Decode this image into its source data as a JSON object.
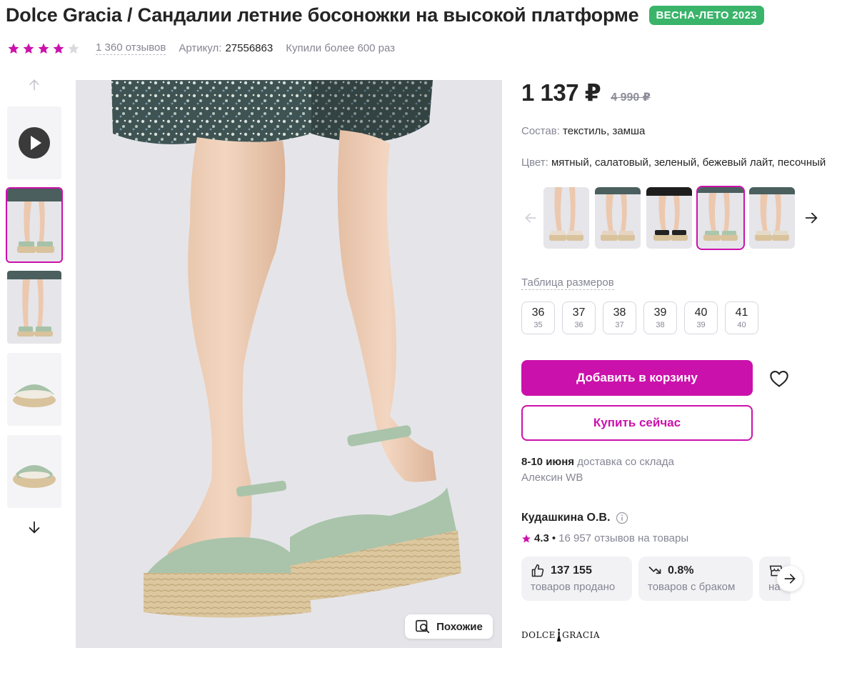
{
  "header": {
    "title": "Dolce Gracia / Сандалии летние босоножки на высокой платформе",
    "season_badge": "ВЕСНА-ЛЕТО 2023"
  },
  "meta": {
    "rating_stars": 4,
    "reviews": "1 360 отзывов",
    "article_label": "Артикул:",
    "article_value": "27556863",
    "bought": "Купили более 600 раз"
  },
  "gallery": {
    "thumbs": [
      {
        "kind": "video",
        "icon": "play-icon"
      },
      {
        "kind": "photo",
        "active": true
      },
      {
        "kind": "photo"
      },
      {
        "kind": "photo"
      },
      {
        "kind": "photo"
      }
    ],
    "similar_label": "Похожие"
  },
  "price": {
    "current": "1 137 ₽",
    "old": "4 990 ₽"
  },
  "attributes": {
    "composition_label": "Состав:",
    "composition_value": "текстиль, замша",
    "color_label": "Цвет:",
    "color_value": "мятный, салатовый, зеленый, бежевый лайт, песочный"
  },
  "color_variants": [
    {
      "color": "#e9dccd"
    },
    {
      "color": "#e6d4c2"
    },
    {
      "color": "#222222"
    },
    {
      "color": "#aac7ae",
      "active": true
    },
    {
      "color": "#e4dac8"
    }
  ],
  "sizes": {
    "table_link": "Таблица размеров",
    "items": [
      {
        "main": "36",
        "sub": "35"
      },
      {
        "main": "37",
        "sub": "36"
      },
      {
        "main": "38",
        "sub": "37"
      },
      {
        "main": "39",
        "sub": "38"
      },
      {
        "main": "40",
        "sub": "39"
      },
      {
        "main": "41",
        "sub": "40"
      }
    ]
  },
  "actions": {
    "add_to_cart": "Добавить в корзину",
    "buy_now": "Купить сейчас"
  },
  "delivery": {
    "date": "8-10 июня",
    "text": "доставка со склада Алексин WB"
  },
  "seller": {
    "name": "Кудашкина О.В.",
    "rating": "4.3",
    "reviews": "16 957 отзывов на товары",
    "stats": [
      {
        "icon": "thumbs-up-icon",
        "value": "137 155",
        "label": "товаров продано"
      },
      {
        "icon": "trend-down-icon",
        "value": "0.8%",
        "label": "товаров с браком"
      },
      {
        "icon": "store-icon",
        "value": "",
        "label": "на"
      }
    ]
  },
  "brand": {
    "logo_left": "DOLCE",
    "logo_right": "GRACIA"
  },
  "colors": {
    "accent": "#cb11ab",
    "badge_green": "#39b46a",
    "star": "#cb11ab",
    "muted_text": "#868695"
  }
}
